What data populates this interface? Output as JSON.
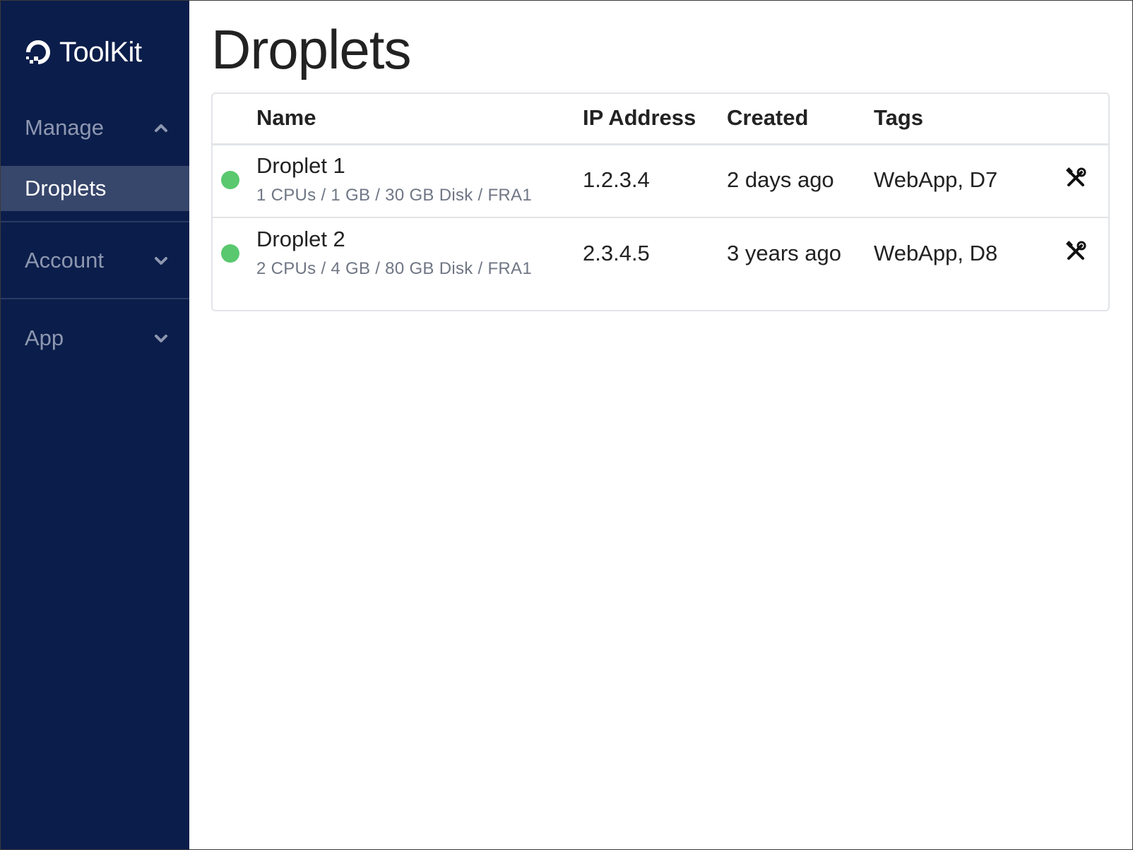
{
  "brand": {
    "name": "ToolKit"
  },
  "sidebar": {
    "sections": [
      {
        "label": "Manage",
        "icon": "chevron-up-icon"
      },
      {
        "label": "Account",
        "icon": "chevron-down-icon"
      },
      {
        "label": "App",
        "icon": "chevron-down-icon"
      }
    ],
    "active_item": {
      "label": "Droplets"
    }
  },
  "page": {
    "title": "Droplets"
  },
  "table": {
    "columns": [
      "Name",
      "IP Address",
      "Created",
      "Tags"
    ],
    "rows": [
      {
        "name": "Droplet 1",
        "specs": "1 CPUs / 1 GB / 30 GB Disk / FRA1",
        "ip": "1.2.3.4",
        "created": "2 days ago",
        "tags": "WebApp, D7",
        "status_color": "#5ac86f",
        "action_icon": "tools-icon"
      },
      {
        "name": "Droplet 2",
        "specs": "2 CPUs / 4 GB / 80 GB Disk / FRA1",
        "ip": "2.3.4.5",
        "created": "3 years ago",
        "tags": "WebApp, D8",
        "status_color": "#5ac86f",
        "action_icon": "tools-icon"
      }
    ]
  },
  "colors": {
    "sidebar_bg": "#0b1d4a",
    "sidebar_active_bg": "#37466b",
    "status_active": "#5ac86f"
  }
}
